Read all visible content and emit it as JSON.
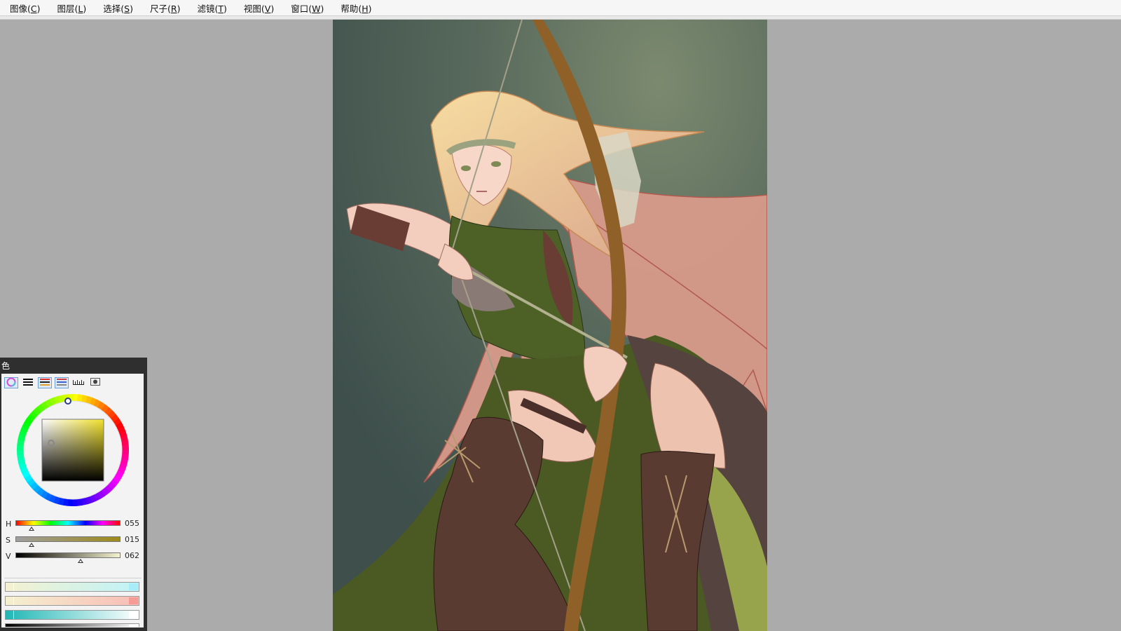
{
  "menu": [
    {
      "label": "图像(",
      "key": "C",
      "tail": ")"
    },
    {
      "label": "图层(",
      "key": "L",
      "tail": ")"
    },
    {
      "label": "选择(",
      "key": "S",
      "tail": ")"
    },
    {
      "label": "尺子(",
      "key": "R",
      "tail": ")"
    },
    {
      "label": "滤镜(",
      "key": "T",
      "tail": ")"
    },
    {
      "label": "视图(",
      "key": "V",
      "tail": ")"
    },
    {
      "label": "窗口(",
      "key": "W",
      "tail": ")"
    },
    {
      "label": "帮助(",
      "key": "H",
      "tail": ")"
    }
  ],
  "color_panel": {
    "title": "色",
    "modes": [
      "color-wheel-icon",
      "rgb-sliders-icon",
      "hsv-sliders-icon",
      "palette-icon",
      "swatches-icon",
      "scratchpad-icon"
    ],
    "active_modes": [
      0,
      2,
      3
    ],
    "hsv": [
      {
        "label": "H",
        "value": "055",
        "fraction": 0.15,
        "gradient": "linear-gradient(to right,#ff0000,#ffff00,#00ff00,#00ffff,#0000ff,#ff00ff,#ff0000)"
      },
      {
        "label": "S",
        "value": "015",
        "fraction": 0.15,
        "gradient": "linear-gradient(to right,#9e9e9e,#9e8b1a)"
      },
      {
        "label": "V",
        "value": "062",
        "fraction": 0.62,
        "gradient": "linear-gradient(to right,#000000,#f5f2d0)"
      }
    ],
    "current_hue_color": "#f2e22c",
    "gradients": [
      {
        "from": "#f5f1d0",
        "to": "#bff3f8",
        "end": "#a8ecf7"
      },
      {
        "from": "#f5f1d0",
        "to": "#f8bdb6",
        "end": "#f59c97"
      },
      {
        "from": "#20b7b5",
        "to": "#ffffff",
        "end": "#ffffff"
      },
      {
        "from": "#000000",
        "to": "#ffffff",
        "end": "#ffffff"
      }
    ]
  }
}
